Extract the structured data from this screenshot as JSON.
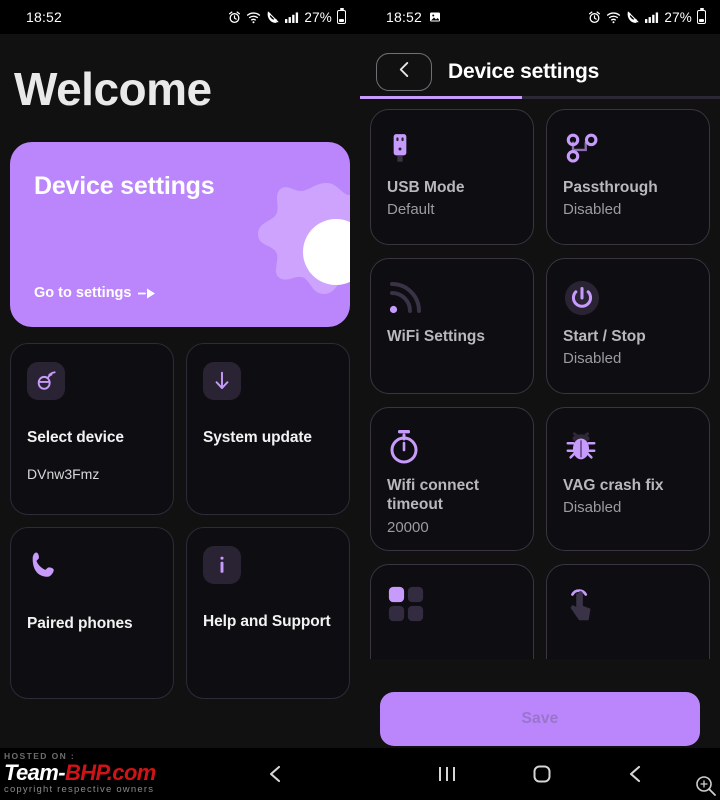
{
  "left": {
    "status": {
      "time": "18:52",
      "battery": "27%",
      "icons": [
        "alarm-icon",
        "wifi-icon",
        "call-mute-icon",
        "signal-icon",
        "battery-icon"
      ]
    },
    "heading": "Welcome",
    "hero": {
      "title": "Device settings",
      "cta": "Go to settings",
      "cta_icon": "arrow-right-icon",
      "bg_color": "#bb86fc"
    },
    "tiles": [
      {
        "title": "Select device",
        "subtitle": "DVnw3Fmz",
        "icon": "device-broadcast-icon"
      },
      {
        "title": "System update",
        "subtitle": "",
        "icon": "download-arrow-icon"
      },
      {
        "title": "Paired phones",
        "subtitle": "",
        "icon": "phone-handset-icon"
      },
      {
        "title": "Help and Support",
        "subtitle": "",
        "icon": "info-icon"
      }
    ],
    "watermark": {
      "hosted": "HOSTED ON :",
      "brand_a": "Team-",
      "brand_b": "BHP.com",
      "copy": "copyright respective owners"
    },
    "nav": {
      "recents": "recents-icon",
      "home": "home-icon",
      "back": "back-icon"
    }
  },
  "right": {
    "status": {
      "time": "18:52",
      "battery": "27%",
      "icons": [
        "image-icon",
        "alarm-icon",
        "wifi-icon",
        "call-mute-icon",
        "signal-icon",
        "battery-icon"
      ]
    },
    "appbar": {
      "back": "chevron-left-icon",
      "title": "Device settings"
    },
    "progress": {
      "percent": 45,
      "color": "#c79bfb"
    },
    "settings": [
      {
        "title": "USB Mode",
        "value": "Default",
        "icon": "usb-icon"
      },
      {
        "title": "Passthrough",
        "value": "Disabled",
        "icon": "passthrough-nodes-icon"
      },
      {
        "title": "WiFi Settings",
        "value": "",
        "icon": "wifi-signal-icon"
      },
      {
        "title": "Start / Stop",
        "value": "Disabled",
        "icon": "power-icon"
      },
      {
        "title": "Wifi connect timeout",
        "value": "20000",
        "icon": "stopwatch-icon"
      },
      {
        "title": "VAG crash fix",
        "value": "Disabled",
        "icon": "bug-icon"
      },
      {
        "title": "",
        "value": "",
        "icon": "grid-apps-icon"
      },
      {
        "title": "",
        "value": "",
        "icon": "tap-gesture-icon"
      }
    ],
    "save_label": "Save",
    "nav": {
      "recents": "recents-icon",
      "home": "home-icon",
      "back": "back-icon",
      "zoom": "zoom-in-icon"
    }
  }
}
